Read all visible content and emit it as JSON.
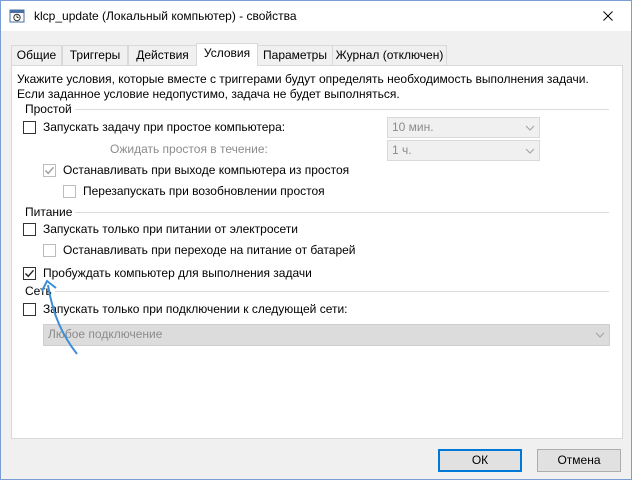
{
  "window": {
    "title": "klcp_update (Локальный компьютер) - свойства"
  },
  "tabs": [
    {
      "label": "Общие"
    },
    {
      "label": "Триггеры"
    },
    {
      "label": "Действия"
    },
    {
      "label": "Условия",
      "active": true
    },
    {
      "label": "Параметры"
    },
    {
      "label": "Журнал (отключен)"
    }
  ],
  "intro": {
    "line1": "Укажите условия, которые вместе с триггерами будут определять необходимость выполнения задачи.",
    "line2": "Если заданное условие недопустимо, задача не будет выполняться."
  },
  "idle": {
    "group_label": "Простой",
    "start_on_idle": {
      "label": "Запускать задачу при простое компьютера:",
      "checked": false
    },
    "idle_duration_value": "10 мин.",
    "wait_label": "Ожидать простоя в течение:",
    "wait_value": "1 ч.",
    "stop_on_idle_end": {
      "label": "Останавливать при выходе компьютера из простоя",
      "checked": true,
      "disabled": true
    },
    "restart_on_idle": {
      "label": "Перезапускать при возобновлении простоя",
      "checked": false,
      "disabled": true
    }
  },
  "power": {
    "group_label": "Питание",
    "ac_only": {
      "label": "Запускать только при питании от электросети",
      "checked": false
    },
    "stop_on_battery": {
      "label": "Останавливать при переходе на питание от батарей",
      "checked": false,
      "disabled": true
    },
    "wake_to_run": {
      "label": "Пробуждать компьютер для выполнения задачи",
      "checked": true
    }
  },
  "network": {
    "group_label": "Сеть",
    "network_only": {
      "label": "Запускать только при подключении к следующей сети:",
      "checked": false
    },
    "network_value": "Любое подключение"
  },
  "buttons": {
    "ok": "ОК",
    "cancel": "Отмена"
  },
  "colors": {
    "accent": "#0078d7",
    "annotation_arrow": "#3c8fd6"
  }
}
